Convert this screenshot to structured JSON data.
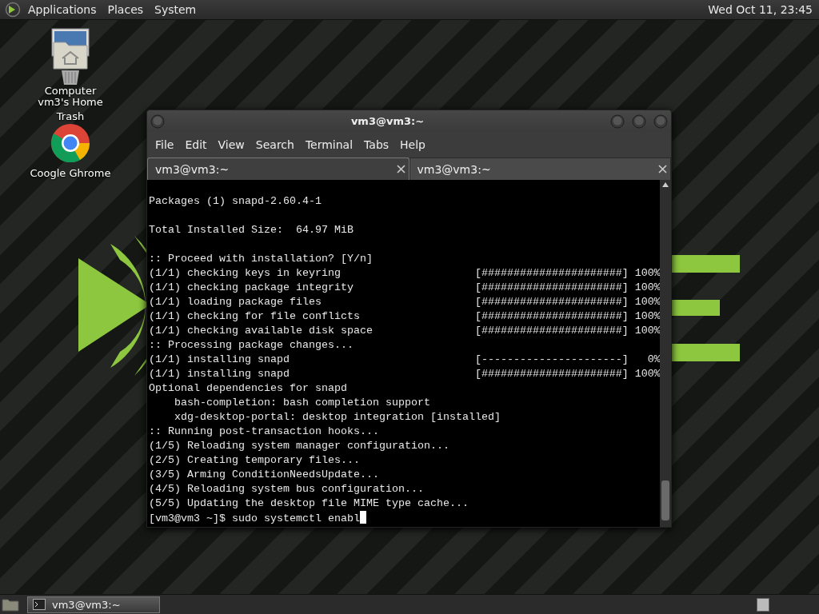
{
  "top_panel": {
    "menus": [
      "Applications",
      "Places",
      "System"
    ],
    "clock": "Wed Oct 11, 23:45"
  },
  "desktop_icons": [
    {
      "kind": "computer",
      "label": "Computer"
    },
    {
      "kind": "home",
      "label": "vm3's Home"
    },
    {
      "kind": "trash",
      "label": "Trash"
    },
    {
      "kind": "browser",
      "label": "Coogle Ghrome"
    }
  ],
  "terminal": {
    "title": "vm3@vm3:~",
    "menu": [
      "File",
      "Edit",
      "View",
      "Search",
      "Terminal",
      "Tabs",
      "Help"
    ],
    "tabs": [
      {
        "label": "vm3@vm3:~",
        "selected": true
      },
      {
        "label": "vm3@vm3:~",
        "selected": false
      }
    ],
    "lines": [
      {
        "text": "Packages (1) snapd-2.60.4-1",
        "space_before": true
      },
      {
        "text": "Total Installed Size:  64.97 MiB",
        "space_before": true
      },
      {
        "text": ":: Proceed with installation? [Y/n]",
        "space_before": true
      },
      {
        "text": "(1/1) checking keys in keyring                     [######################] 100%"
      },
      {
        "text": "(1/1) checking package integrity                   [######################] 100%"
      },
      {
        "text": "(1/1) loading package files                        [######################] 100%"
      },
      {
        "text": "(1/1) checking for file conflicts                  [######################] 100%"
      },
      {
        "text": "(1/1) checking available disk space                [######################] 100%"
      },
      {
        "text": ":: Processing package changes..."
      },
      {
        "text": "(1/1) installing snapd                             [----------------------]   0%"
      },
      {
        "text": "(1/1) installing snapd                             [######################] 100%"
      },
      {
        "text": "Optional dependencies for snapd"
      },
      {
        "text": "    bash-completion: bash completion support"
      },
      {
        "text": "    xdg-desktop-portal: desktop integration [installed]"
      },
      {
        "text": ":: Running post-transaction hooks..."
      },
      {
        "text": "(1/5) Reloading system manager configuration..."
      },
      {
        "text": "(2/5) Creating temporary files..."
      },
      {
        "text": "(3/5) Arming ConditionNeedsUpdate..."
      },
      {
        "text": "(4/5) Reloading system bus configuration..."
      },
      {
        "text": "(5/5) Updating the desktop file MIME type cache..."
      }
    ],
    "prompt": "[vm3@vm3 ~]$ sudo systemctl enabl"
  },
  "taskbar": {
    "tasks": [
      {
        "label": "vm3@vm3:~",
        "selected": true
      }
    ]
  }
}
